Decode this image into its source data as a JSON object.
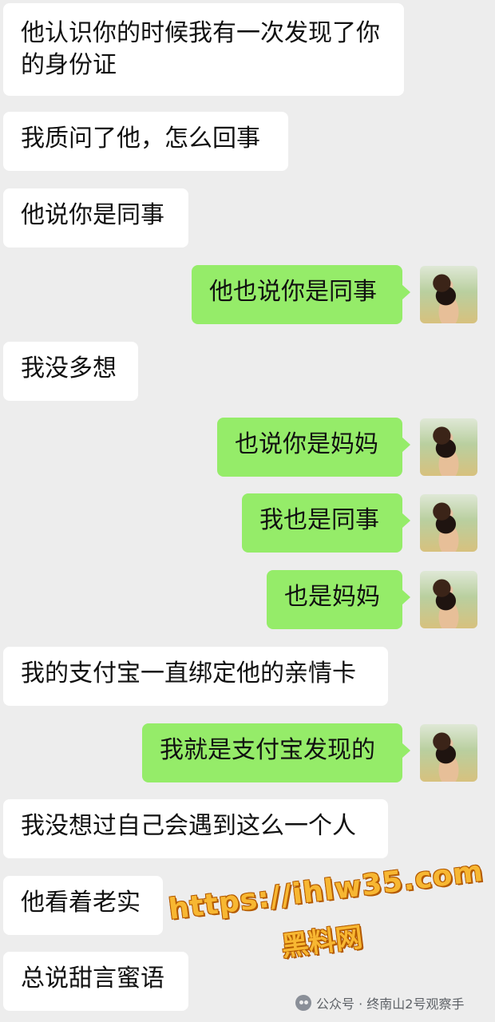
{
  "messages": [
    {
      "side": "left",
      "lines": [
        "他认识你的时候我有一次发现了你",
        "的身份证"
      ]
    },
    {
      "side": "left",
      "lines": [
        "我质问了他，怎么回事"
      ]
    },
    {
      "side": "left",
      "lines": [
        "他说你是同事"
      ]
    },
    {
      "side": "right",
      "lines": [
        "他也说你是同事"
      ],
      "avatar": "avatar-photo-icon"
    },
    {
      "side": "left",
      "lines": [
        "我没多想"
      ]
    },
    {
      "side": "right",
      "lines": [
        "也说你是妈妈"
      ],
      "avatar": "avatar-photo-icon"
    },
    {
      "side": "right",
      "lines": [
        "我也是同事"
      ],
      "avatar": "avatar-photo-icon"
    },
    {
      "side": "right",
      "lines": [
        "也是妈妈"
      ],
      "avatar": "avatar-photo-icon"
    },
    {
      "side": "left",
      "lines": [
        "我的支付宝一直绑定他的亲情卡"
      ]
    },
    {
      "side": "right",
      "lines": [
        "我就是支付宝发现的"
      ],
      "avatar": "avatar-photo-icon"
    },
    {
      "side": "left",
      "lines": [
        "我没想过自己会遇到这么一个人"
      ]
    },
    {
      "side": "left",
      "lines": [
        "他看着老实"
      ]
    },
    {
      "side": "left",
      "lines": [
        "总说甜言蜜语"
      ]
    }
  ],
  "watermark": {
    "url": "https://ihlw35.com",
    "text": "黑料网"
  },
  "footer": {
    "icon": "wechat-official-account-icon",
    "text": "公众号 · 终南山2号观察手"
  },
  "colors": {
    "background": "#ededed",
    "left_bubble": "#ffffff",
    "right_bubble": "#95ec69",
    "watermark": "#f7b732"
  }
}
